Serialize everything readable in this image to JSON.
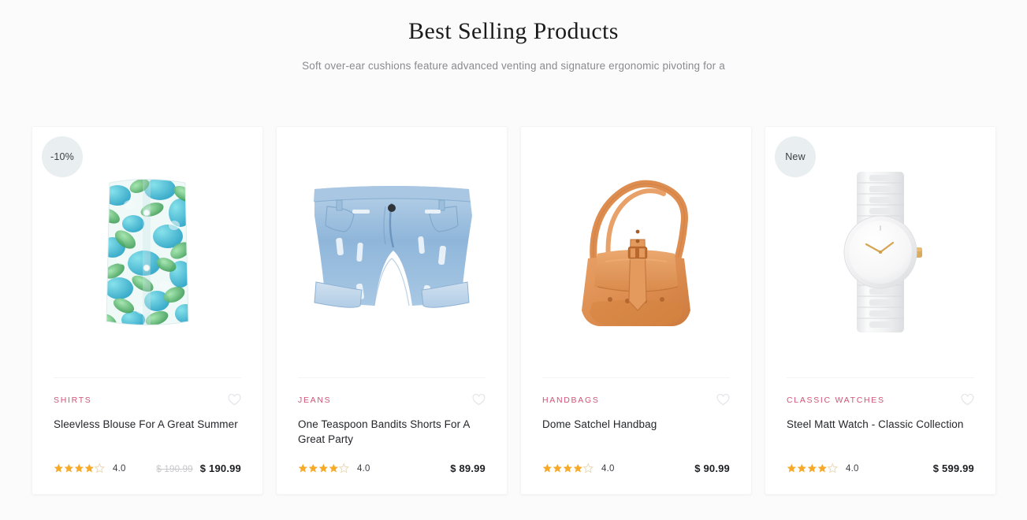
{
  "section": {
    "title": "Best Selling Products",
    "subtitle": "Soft over-ear cushions feature advanced venting and signature ergonomic pivoting for a"
  },
  "theme": {
    "page_background": "#fbfbfc",
    "card_background": "#ffffff",
    "category_color": "#d1537a",
    "badge_background": "#e9eef1",
    "star_filled_color": "#f7a928",
    "star_empty_color": "#e8d9bd",
    "price_color": "#1d1e22",
    "old_price_color": "#c7c7cc",
    "heart_color": "#e6e6ea"
  },
  "products": [
    {
      "badge": "-10%",
      "category": "SHIRTS",
      "title": "Sleevless Blouse For A Great Summer",
      "rating": "4.0",
      "stars_filled": 4,
      "stars_total": 5,
      "old_price": "$ 190.99",
      "price": "$ 190.99",
      "image_name": "floral-blouse-image",
      "wishlist_icon": "heart-outline-icon"
    },
    {
      "badge": "",
      "category": "JEANS",
      "title": "One Teaspoon Bandits Shorts For A Great Party",
      "rating": "4.0",
      "stars_filled": 4,
      "stars_total": 5,
      "old_price": "",
      "price": "$ 89.99",
      "image_name": "denim-shorts-image",
      "wishlist_icon": "heart-outline-icon"
    },
    {
      "badge": "",
      "category": "HANDBAGS",
      "title": "Dome Satchel Handbag",
      "rating": "4.0",
      "stars_filled": 4,
      "stars_total": 5,
      "old_price": "",
      "price": "$ 90.99",
      "image_name": "tan-satchel-handbag-image",
      "wishlist_icon": "heart-outline-icon"
    },
    {
      "badge": "New",
      "category": "CLASSIC WATCHES",
      "title": "Steel Matt Watch - Classic Collection",
      "rating": "4.0",
      "stars_filled": 4,
      "stars_total": 5,
      "old_price": "",
      "price": "$ 599.99",
      "image_name": "white-steel-watch-image",
      "wishlist_icon": "heart-outline-icon"
    }
  ]
}
